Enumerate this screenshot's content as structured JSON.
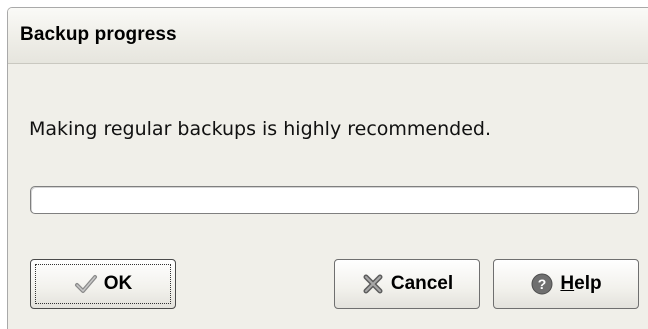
{
  "window": {
    "title": "Backup progress"
  },
  "message": "Making regular backups is highly recommended.",
  "progress": {
    "value": 0
  },
  "buttons": {
    "ok_label": "OK",
    "cancel_label": "Cancel",
    "help_label_first": "H",
    "help_label_rest": "elp"
  },
  "icons": {
    "ok": "checkmark-icon",
    "cancel": "cancel-x-icon",
    "help": "help-question-icon"
  },
  "colors": {
    "dialog_bg": "#f0efe9",
    "progress_bg": "#ffffff",
    "progress_border": "#7f7f7f"
  }
}
